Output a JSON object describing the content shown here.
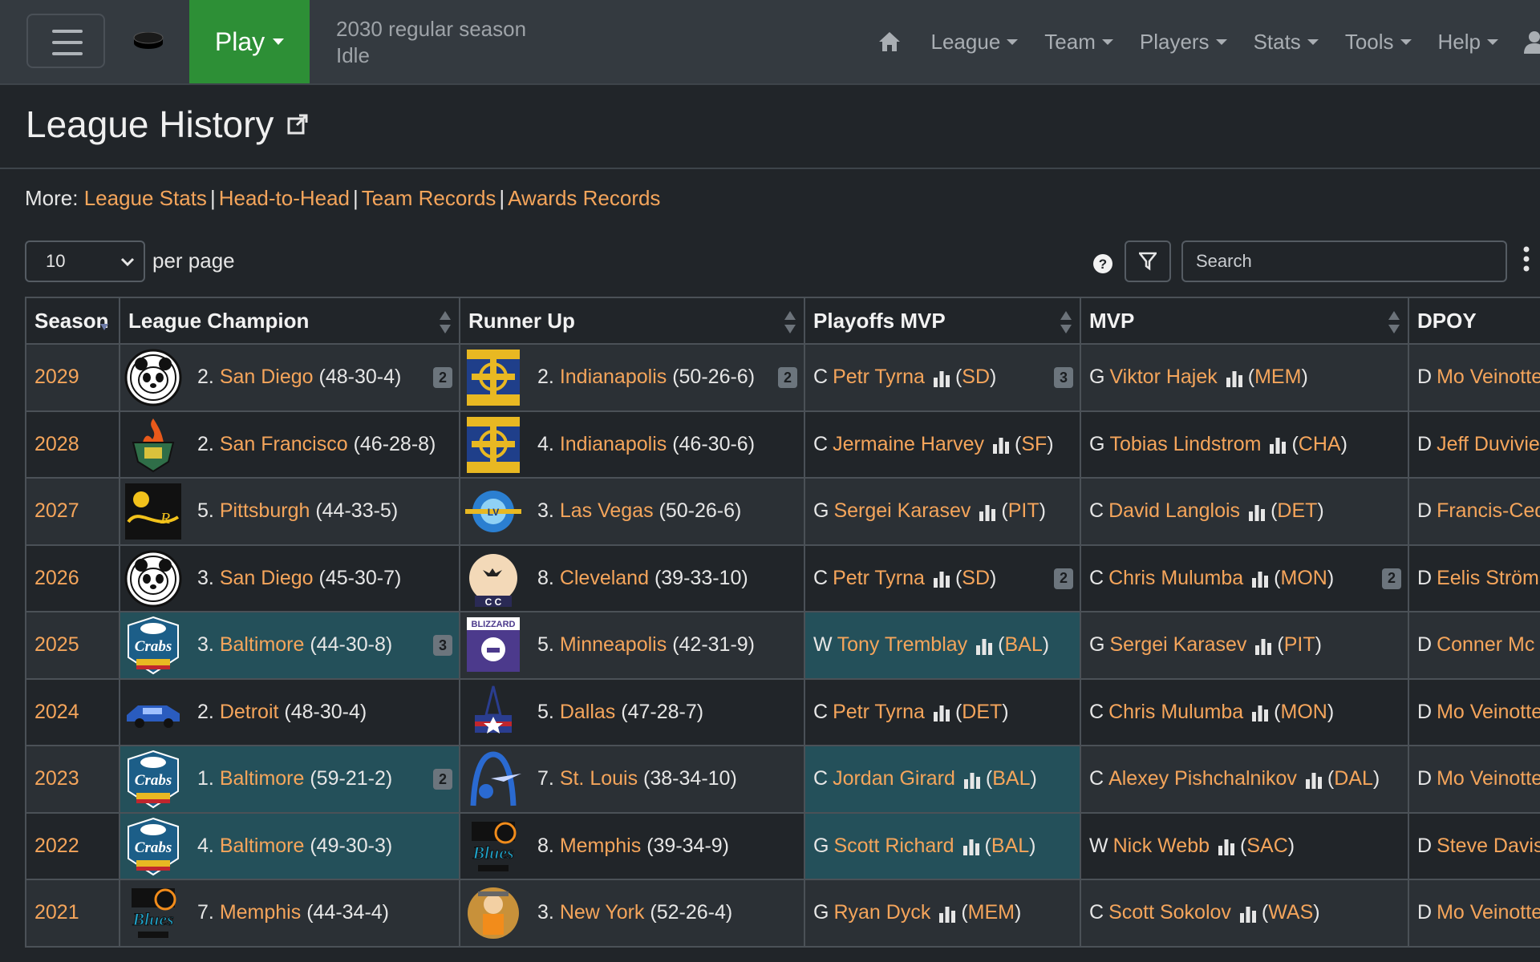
{
  "nav": {
    "play_label": "Play",
    "season_line": "2030 regular season",
    "status_line": "Idle",
    "items": [
      {
        "label": "League"
      },
      {
        "label": "Team"
      },
      {
        "label": "Players"
      },
      {
        "label": "Stats"
      },
      {
        "label": "Tools"
      },
      {
        "label": "Help"
      }
    ]
  },
  "page": {
    "title": "League History",
    "more_label": "More:",
    "more_links": [
      "League Stats",
      "Head-to-Head",
      "Team Records",
      "Awards Records"
    ]
  },
  "controls": {
    "per_page_value": "10",
    "per_page_label": "per page",
    "search_placeholder": "Search"
  },
  "table": {
    "headers": [
      "Season",
      "League Champion",
      "Runner Up",
      "Playoffs MVP",
      "MVP",
      "DPOY"
    ],
    "rows": [
      {
        "season": "2029",
        "champ": {
          "seed": "2.",
          "team": "San Diego",
          "record": "(48-30-4)",
          "badge": "2",
          "logo": "panda"
        },
        "runner": {
          "seed": "2.",
          "team": "Indianapolis",
          "record": "(50-26-6)",
          "badge": "2",
          "logo": "crossroads"
        },
        "pmvp": {
          "pos": "C",
          "name": "Petr Tyrna",
          "abbr": "SD",
          "badge": "3"
        },
        "mvp": {
          "pos": "G",
          "name": "Viktor Hajek",
          "abbr": "MEM",
          "badge": ""
        },
        "dpoy": {
          "pos": "D",
          "name": "Mo Veinotte"
        }
      },
      {
        "season": "2028",
        "champ": {
          "seed": "2.",
          "team": "San Francisco",
          "record": "(46-28-8)",
          "badge": "",
          "logo": "flame"
        },
        "runner": {
          "seed": "4.",
          "team": "Indianapolis",
          "record": "(46-30-6)",
          "badge": "",
          "logo": "crossroads"
        },
        "pmvp": {
          "pos": "C",
          "name": "Jermaine Harvey",
          "abbr": "SF",
          "badge": ""
        },
        "mvp": {
          "pos": "G",
          "name": "Tobias Lindstrom",
          "abbr": "CHA",
          "badge": ""
        },
        "dpoy": {
          "pos": "D",
          "name": "Jeff Duvivier"
        }
      },
      {
        "season": "2027",
        "champ": {
          "seed": "5.",
          "team": "Pittsburgh",
          "record": "(44-33-5)",
          "badge": "",
          "logo": "pitt"
        },
        "runner": {
          "seed": "3.",
          "team": "Las Vegas",
          "record": "(50-26-6)",
          "badge": "",
          "logo": "chip"
        },
        "pmvp": {
          "pos": "G",
          "name": "Sergei Karasev",
          "abbr": "PIT",
          "badge": ""
        },
        "mvp": {
          "pos": "C",
          "name": "David Langlois",
          "abbr": "DET",
          "badge": ""
        },
        "dpoy": {
          "pos": "D",
          "name": "Francis-Cedric"
        }
      },
      {
        "season": "2026",
        "champ": {
          "seed": "3.",
          "team": "San Diego",
          "record": "(45-30-7)",
          "badge": "",
          "logo": "panda"
        },
        "runner": {
          "seed": "8.",
          "team": "Cleveland",
          "record": "(39-33-10)",
          "badge": "",
          "logo": "moon"
        },
        "pmvp": {
          "pos": "C",
          "name": "Petr Tyrna",
          "abbr": "SD",
          "badge": "2"
        },
        "mvp": {
          "pos": "C",
          "name": "Chris Mulumba",
          "abbr": "MON",
          "badge": "2"
        },
        "dpoy": {
          "pos": "D",
          "name": "Eelis Ström"
        }
      },
      {
        "season": "2025",
        "champ": {
          "seed": "3.",
          "team": "Baltimore",
          "record": "(44-30-8)",
          "badge": "3",
          "logo": "crabs",
          "hl": true
        },
        "runner": {
          "seed": "5.",
          "team": "Minneapolis",
          "record": "(42-31-9)",
          "badge": "",
          "logo": "blizzard"
        },
        "pmvp": {
          "pos": "W",
          "name": "Tony Tremblay",
          "abbr": "BAL",
          "badge": "",
          "hl": true
        },
        "mvp": {
          "pos": "G",
          "name": "Sergei Karasev",
          "abbr": "PIT",
          "badge": ""
        },
        "dpoy": {
          "pos": "D",
          "name": "Conner Mc"
        }
      },
      {
        "season": "2024",
        "champ": {
          "seed": "2.",
          "team": "Detroit",
          "record": "(48-30-4)",
          "badge": "",
          "logo": "car"
        },
        "runner": {
          "seed": "5.",
          "team": "Dallas",
          "record": "(47-28-7)",
          "badge": "",
          "logo": "dallas"
        },
        "pmvp": {
          "pos": "C",
          "name": "Petr Tyrna",
          "abbr": "DET",
          "badge": ""
        },
        "mvp": {
          "pos": "C",
          "name": "Chris Mulumba",
          "abbr": "MON",
          "badge": ""
        },
        "dpoy": {
          "pos": "D",
          "name": "Mo Veinotte"
        }
      },
      {
        "season": "2023",
        "champ": {
          "seed": "1.",
          "team": "Baltimore",
          "record": "(59-21-2)",
          "badge": "2",
          "logo": "crabs",
          "hl": true
        },
        "runner": {
          "seed": "7.",
          "team": "St. Louis",
          "record": "(38-34-10)",
          "badge": "",
          "logo": "arch"
        },
        "pmvp": {
          "pos": "C",
          "name": "Jordan Girard",
          "abbr": "BAL",
          "badge": "",
          "hl": true
        },
        "mvp": {
          "pos": "C",
          "name": "Alexey Pishchalnikov",
          "abbr": "DAL",
          "badge": ""
        },
        "dpoy": {
          "pos": "D",
          "name": "Mo Veinotte"
        }
      },
      {
        "season": "2022",
        "champ": {
          "seed": "4.",
          "team": "Baltimore",
          "record": "(49-30-3)",
          "badge": "",
          "logo": "crabs",
          "hl": true
        },
        "runner": {
          "seed": "8.",
          "team": "Memphis",
          "record": "(39-34-9)",
          "badge": "",
          "logo": "blues"
        },
        "pmvp": {
          "pos": "G",
          "name": "Scott Richard",
          "abbr": "BAL",
          "badge": "",
          "hl": true
        },
        "mvp": {
          "pos": "W",
          "name": "Nick Webb",
          "abbr": "SAC",
          "badge": ""
        },
        "dpoy": {
          "pos": "D",
          "name": "Steve Davis"
        }
      },
      {
        "season": "2021",
        "champ": {
          "seed": "7.",
          "team": "Memphis",
          "record": "(44-34-4)",
          "badge": "",
          "logo": "blues"
        },
        "runner": {
          "seed": "3.",
          "team": "New York",
          "record": "(52-26-4)",
          "badge": "",
          "logo": "ny"
        },
        "pmvp": {
          "pos": "G",
          "name": "Ryan Dyck",
          "abbr": "MEM",
          "badge": ""
        },
        "mvp": {
          "pos": "C",
          "name": "Scott Sokolov",
          "abbr": "WAS",
          "badge": ""
        },
        "dpoy": {
          "pos": "D",
          "name": "Mo Veinotte"
        }
      }
    ]
  },
  "colors": {
    "link": "#f5a55b",
    "highlight": "#24505a",
    "play": "#2d8f36"
  }
}
